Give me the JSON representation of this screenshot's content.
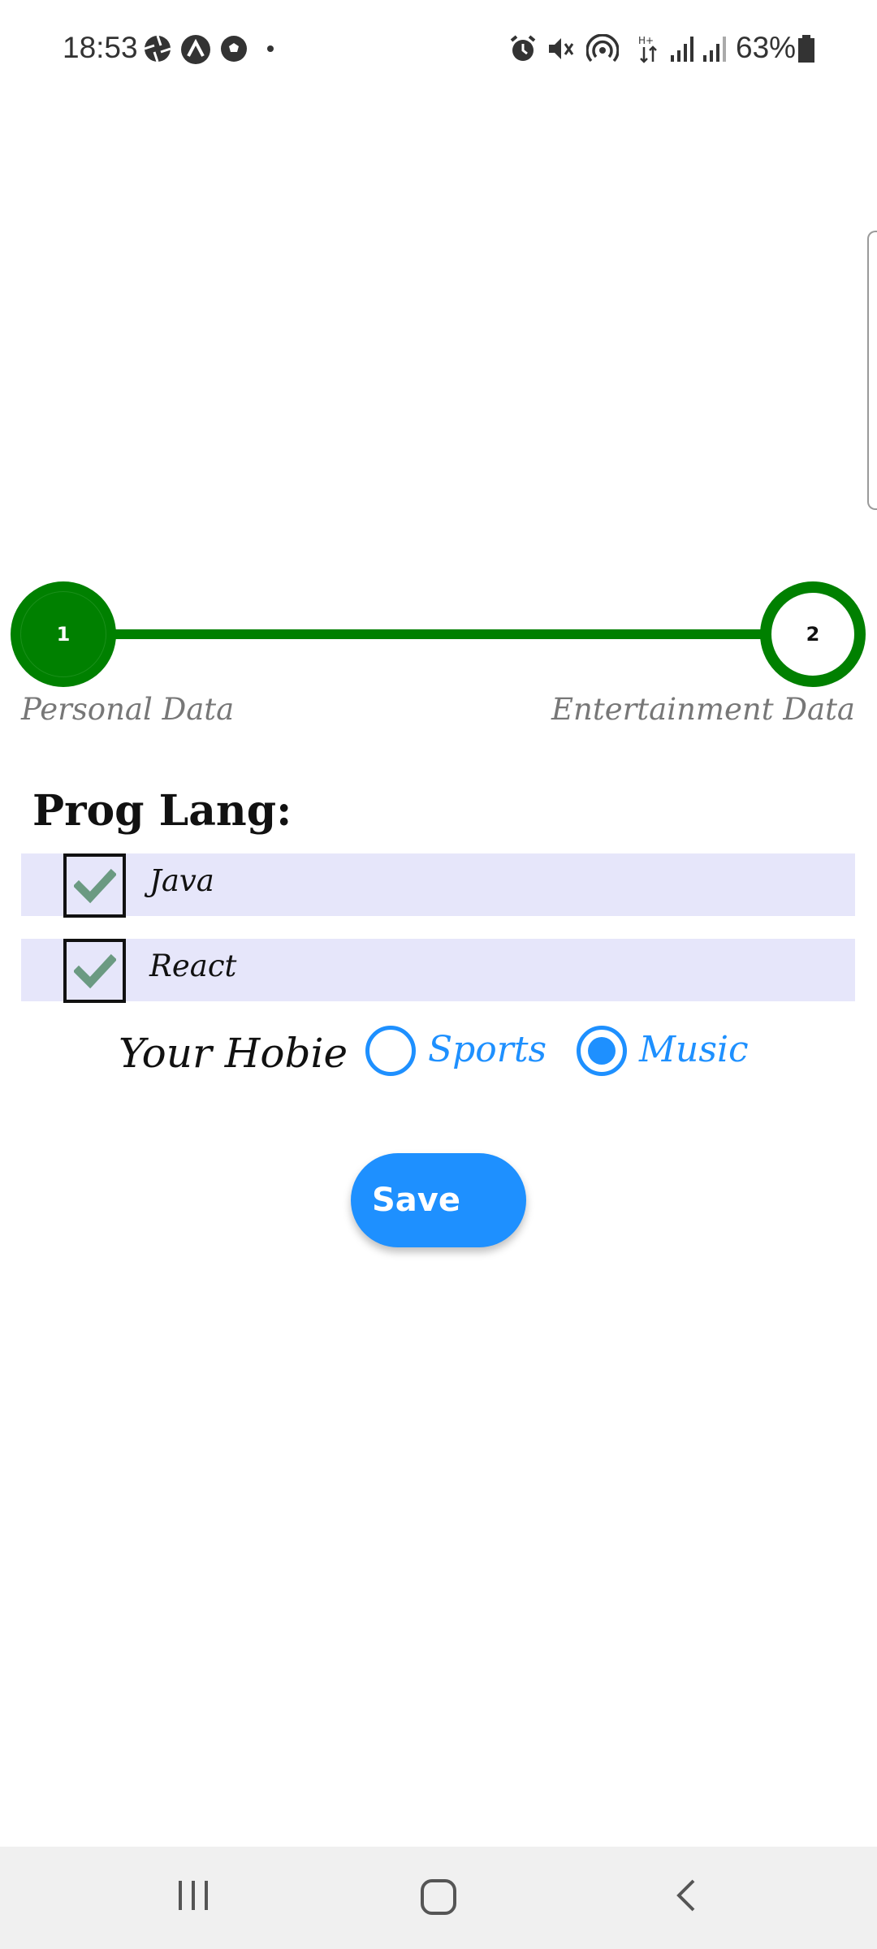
{
  "status_bar": {
    "time": "18:53",
    "battery_percent": "63%",
    "left_icons": [
      "aperture-icon",
      "arch-icon",
      "soccer-ball-icon",
      "dot-icon"
    ],
    "right_icons": [
      "alarm-icon",
      "mute-icon",
      "hotspot-icon",
      "data-arrows-icon",
      "signal-icon",
      "signal-icon",
      "battery-icon"
    ]
  },
  "stepper": {
    "steps": [
      {
        "number": "1",
        "label": "Personal Data",
        "state": "active"
      },
      {
        "number": "2",
        "label": "Entertainment Data",
        "state": "current"
      }
    ],
    "line_color": "#008000"
  },
  "prog_lang": {
    "title": "Prog Lang:",
    "options": [
      {
        "label": "Java",
        "checked": true
      },
      {
        "label": "React",
        "checked": true
      }
    ]
  },
  "hobby": {
    "title": "Your Hobie",
    "options": [
      {
        "label": "Sports",
        "selected": false
      },
      {
        "label": "Music",
        "selected": true
      }
    ],
    "accent_color": "#1e90ff"
  },
  "save_label": "Save",
  "nav_bar": {
    "buttons": [
      "recent-apps",
      "home",
      "back"
    ]
  },
  "colors": {
    "checkmark": "#6b9a82",
    "row_background": "#e6e6fa"
  }
}
